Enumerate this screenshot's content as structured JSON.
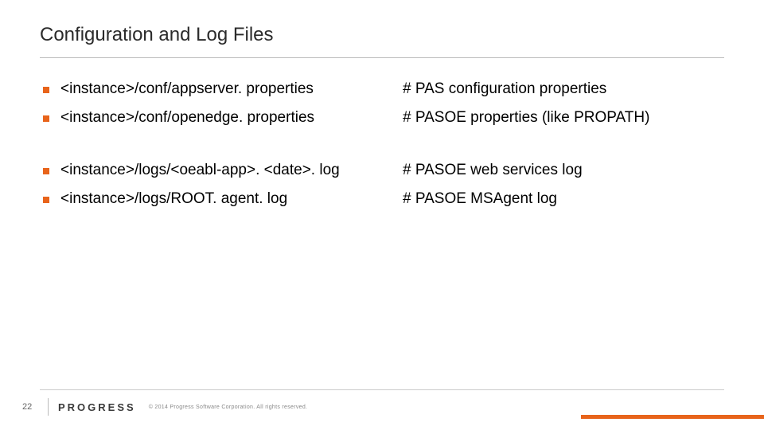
{
  "title": "Configuration and Log Files",
  "items": [
    {
      "path": "<instance>/conf/appserver. properties",
      "desc": "# PAS configuration properties"
    },
    {
      "path": "<instance>/conf/openedge. properties",
      "desc": "# PASOE properties (like PROPATH)"
    },
    {
      "path": "<instance>/logs/<oeabl-app>. <date>. log",
      "desc": "# PASOE web services log"
    },
    {
      "path": "<instance>/logs/ROOT. agent. log",
      "desc": "# PASOE MSAgent log"
    }
  ],
  "footer": {
    "page": "22",
    "logo": "PROGRESS",
    "copyright": "© 2014 Progress Software Corporation. All rights reserved."
  },
  "colors": {
    "accent": "#e8641b"
  }
}
